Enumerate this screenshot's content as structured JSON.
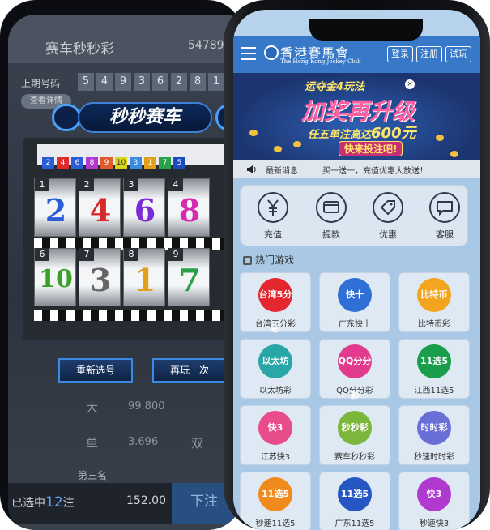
{
  "back_app": {
    "title": "赛车秒秒彩",
    "id_partial": "54789",
    "last_period_label": "上期号码",
    "last_numbers": [
      "5",
      "4",
      "9",
      "3",
      "6",
      "2",
      "8",
      "1"
    ],
    "pill_label": "查看详情",
    "slot_title": "秒秒赛车",
    "mini_numbers": [
      "2",
      "4",
      "6",
      "8",
      "9",
      "10",
      "3",
      "1",
      "7",
      "5"
    ],
    "reel_positions_top": [
      "1",
      "2",
      "3",
      "4"
    ],
    "reel_numbers_top": [
      "2",
      "4",
      "6",
      "8"
    ],
    "reel_positions_bottom": [
      "6",
      "7",
      "8",
      "9"
    ],
    "reel_numbers_bottom": [
      "10",
      "3",
      "1",
      "7"
    ],
    "btn_reselect": "重新选号",
    "btn_replay": "再玩一次",
    "row_big_label": "大",
    "row_big_value": "99.800",
    "row_small_label": "单",
    "row_small_value": "3.696",
    "row_small_right": "双",
    "third_label": "第三名",
    "selected_prefix": "已选中",
    "selected_count": "12",
    "selected_suffix": "注",
    "amount": "152.00",
    "bet_button": "下注"
  },
  "front_app": {
    "logo_cn": "香港賽馬會",
    "logo_en": "The Hong Kong Jockey Club",
    "login": "登录",
    "register": "注册",
    "trial": "试玩",
    "banner": {
      "tag": "运夺金4玩法",
      "main": "加奖再升级",
      "sub_prefix": "任五单注高达",
      "sub_amount": "600元",
      "cta": "快来投注吧!"
    },
    "notice_label": "最新消息：",
    "notice_text": "买一送一，充值优惠大放送！",
    "quick_actions": [
      {
        "label": "充值",
        "icon": "yen-icon"
      },
      {
        "label": "提款",
        "icon": "card-icon"
      },
      {
        "label": "优惠",
        "icon": "tag-icon"
      },
      {
        "label": "客服",
        "icon": "chat-icon"
      }
    ],
    "hot_title": "热门游戏",
    "games": [
      {
        "label": "台湾五分彩",
        "icon_text": "台湾5分彩",
        "color": "#e4262f"
      },
      {
        "label": "广东快十",
        "icon_text": "快十",
        "color": "#2f6fd6"
      },
      {
        "label": "比特币彩",
        "icon_text": "比特币",
        "color": "#f3a520"
      },
      {
        "label": "以太坊彩",
        "icon_text": "以太坊",
        "color": "#28a6a8"
      },
      {
        "label": "QQ分分彩",
        "icon_text": "QQ分分彩",
        "color": "#e23b8e"
      },
      {
        "label": "江西11选5",
        "icon_text": "11选5",
        "color": "#1a9e4b"
      },
      {
        "label": "江苏快3",
        "icon_text": "快3",
        "color": "#e84c8b"
      },
      {
        "label": "赛车秒秒彩",
        "icon_text": "秒秒彩",
        "color": "#7ab73a"
      },
      {
        "label": "秒速时时彩",
        "icon_text": "时时彩",
        "color": "#6a6fd8"
      },
      {
        "label": "秒速11选5",
        "icon_text": "11选5",
        "color": "#f08a1c"
      },
      {
        "label": "广东11选5",
        "icon_text": "11选5",
        "color": "#2656c4"
      },
      {
        "label": "秒速快3",
        "icon_text": "快3",
        "color": "#b03ad0"
      }
    ]
  }
}
